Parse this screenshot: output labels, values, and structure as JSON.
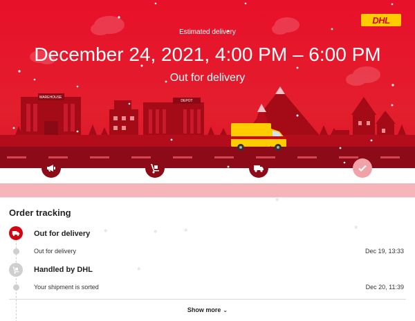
{
  "brand": {
    "logo_text": "DHL",
    "logo_bg": "#ffcc00",
    "logo_fg": "#d40511",
    "accent": "#d40511"
  },
  "hero": {
    "estimated_label": "Estimated delivery",
    "eta": "December 24, 2021, 4:00 PM – 6:00 PM",
    "status": "Out for delivery",
    "scene_labels": {
      "warehouse": "WAREHOUSE",
      "depot": "DEPOT"
    }
  },
  "progress_steps": [
    {
      "icon": "megaphone-icon",
      "state": "active"
    },
    {
      "icon": "hand-truck-icon",
      "state": "active"
    },
    {
      "icon": "delivery-truck-icon",
      "state": "active"
    },
    {
      "icon": "checkmark-icon",
      "state": "pending"
    }
  ],
  "tracking": {
    "title": "Order tracking",
    "events": [
      {
        "heading": "Out for delivery",
        "icon": "delivery-truck-icon",
        "detail": "Out for delivery",
        "time": "Dec 19, 13:33"
      },
      {
        "heading": "Handled by DHL",
        "icon": "hand-truck-icon",
        "detail": "Your shipment is sorted",
        "time": "Dec 20, 11:39"
      }
    ],
    "show_more": "Show more"
  }
}
